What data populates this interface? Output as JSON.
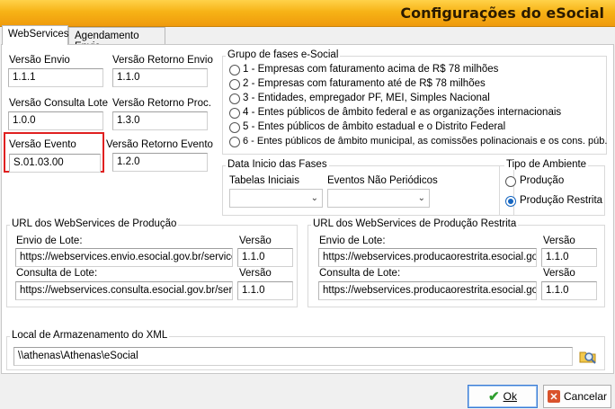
{
  "window": {
    "title": "Configurações do eSocial"
  },
  "tabs": [
    {
      "label": "WebServices",
      "active": true
    },
    {
      "label": "Agendamento Envio",
      "active": false
    }
  ],
  "versions": {
    "envio_label": "Versão Envio",
    "envio_value": "1.1.1",
    "retorno_envio_label": "Versão Retorno Envio",
    "retorno_envio_value": "1.1.0",
    "consulta_lote_label": "Versão Consulta Lote",
    "consulta_lote_value": "1.0.0",
    "retorno_proc_label": "Versão Retorno Proc.",
    "retorno_proc_value": "1.3.0",
    "evento_label": "Versão Evento",
    "evento_value": "S.01.03.00",
    "retorno_evento_label": "Versão Retorno Evento",
    "retorno_evento_value": "1.2.0"
  },
  "fases": {
    "title": "Grupo de fases e-Social",
    "options": [
      "1 - Empresas com faturamento acima de R$ 78 milhões",
      "2 - Empresas com faturamento até de R$ 78 milhões",
      "3 - Entidades, empregador PF, MEI, Simples Nacional",
      "4 - Entes públicos de âmbito federal e as organizações internacionais",
      "5 - Entes públicos de âmbito estadual e o Distrito Federal",
      "6 - Entes públicos de âmbito municipal, as comissões polinacionais e os cons. púb."
    ]
  },
  "data_inicio": {
    "title": "Data Inicio das Fases",
    "tabelas_label": "Tabelas Iniciais",
    "tabelas_value": "",
    "eventos_label": "Eventos Não Periódicos",
    "eventos_value": ""
  },
  "ambiente": {
    "title": "Tipo de Ambiente",
    "options": [
      "Produção",
      "Produção Restrita"
    ],
    "selected": "Produção Restrita"
  },
  "producao": {
    "title": "URL dos WebServices de Produção",
    "envio_label": "Envio de Lote:",
    "envio_url": "https://webservices.envio.esocial.gov.br/servicos",
    "envio_versao_label": "Versão",
    "envio_versao": "1.1.0",
    "consulta_label": "Consulta de Lote:",
    "consulta_url": "https://webservices.consulta.esocial.gov.br/servic",
    "consulta_versao_label": "Versão",
    "consulta_versao": "1.1.0"
  },
  "restrita": {
    "title": "URL dos WebServices de Produção Restrita",
    "envio_label": "Envio de Lote:",
    "envio_url": "https://webservices.producaorestrita.esocial.gov.b",
    "envio_versao_label": "Versão",
    "envio_versao": "1.1.0",
    "consulta_label": "Consulta de Lote:",
    "consulta_url": "https://webservices.producaorestrita.esocial.gov.b",
    "consulta_versao_label": "Versão",
    "consulta_versao": "1.1.0"
  },
  "xml": {
    "title": "Local de Armazenamento do XML",
    "path": "\\\\athenas\\Athenas\\eSocial"
  },
  "buttons": {
    "ok": "Ok",
    "cancel": "Cancelar"
  },
  "colors": {
    "title_bar": "#f7b316",
    "highlight": "#e02020",
    "ok_check": "#2e9e2e",
    "cancel_x": "#d9532c"
  }
}
